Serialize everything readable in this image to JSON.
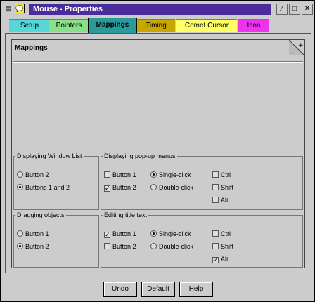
{
  "window": {
    "title": "Mouse - Properties"
  },
  "titlebar_buttons": {
    "sys_icon": "system-menu-icon",
    "app_icon": "speech-bubble-icon",
    "minimize": "∕",
    "maximize": "□",
    "close": "✕"
  },
  "tabs": [
    {
      "label": "Setup",
      "color": "#55d7d7",
      "active": false
    },
    {
      "label": "Pointers",
      "color": "#88e088",
      "active": false
    },
    {
      "label": "Mappings",
      "color": "#2c9a9a",
      "active": true
    },
    {
      "label": "Timing",
      "color": "#c8a700",
      "active": false
    },
    {
      "label": "Comet Cursor",
      "color": "#ffff66",
      "active": false
    },
    {
      "label": "Icon",
      "color": "#ee33ee",
      "active": false
    }
  ],
  "page": {
    "title": "Mappings"
  },
  "groups": {
    "window_list": {
      "legend": "Displaying Window List",
      "options": [
        "Button 2",
        "Buttons 1 and 2"
      ],
      "selected": 1
    },
    "popup": {
      "legend": "Displaying pop-up menus",
      "button1": "Button 1",
      "button2": "Button 2",
      "single": "Single-click",
      "double": "Double-click",
      "ctrl": "Ctrl",
      "shift": "Shift",
      "alt": "Alt"
    },
    "dragging": {
      "legend": "Dragging objects",
      "options": [
        "Button 1",
        "Button 2"
      ],
      "selected": 1
    },
    "editing": {
      "legend": "Editing title text",
      "button1": "Button 1",
      "button2": "Button 2",
      "single": "Single-click",
      "double": "Double-click",
      "ctrl": "Ctrl",
      "shift": "Shift",
      "alt": "Alt"
    }
  },
  "buttons": {
    "undo": "Undo",
    "default": "Default",
    "help": "Help"
  }
}
